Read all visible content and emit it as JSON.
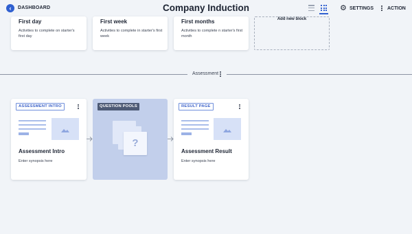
{
  "header": {
    "back_label": "DASHBOARD",
    "title": "Company Induction",
    "settings_label": "SETTINGS",
    "action_label": "ACTION"
  },
  "top_cards": [
    {
      "title": "First day",
      "desc": "Activities to complete on starter's first day"
    },
    {
      "title": "First week",
      "desc": "Activities to complete in starter's first week"
    },
    {
      "title": "First months",
      "desc": "Activities to complete n starter's first month"
    }
  ],
  "add_block_label": "Add new block",
  "section": {
    "label": "Assessment"
  },
  "assessment_cards": [
    {
      "badge": "ASSESSMENT INTRO",
      "title": "Assessment Intro",
      "desc": "Enter synopsis here"
    },
    {
      "badge": "QUESTION POOLS"
    },
    {
      "badge": "RESULT PAGE",
      "title": "Assessment Result",
      "desc": "Enter synopsis here"
    }
  ],
  "question_mark": "?",
  "colors": {
    "accent": "#2f5fd0",
    "pool_bg": "#c2cfeb",
    "background": "#f1f4f8"
  }
}
